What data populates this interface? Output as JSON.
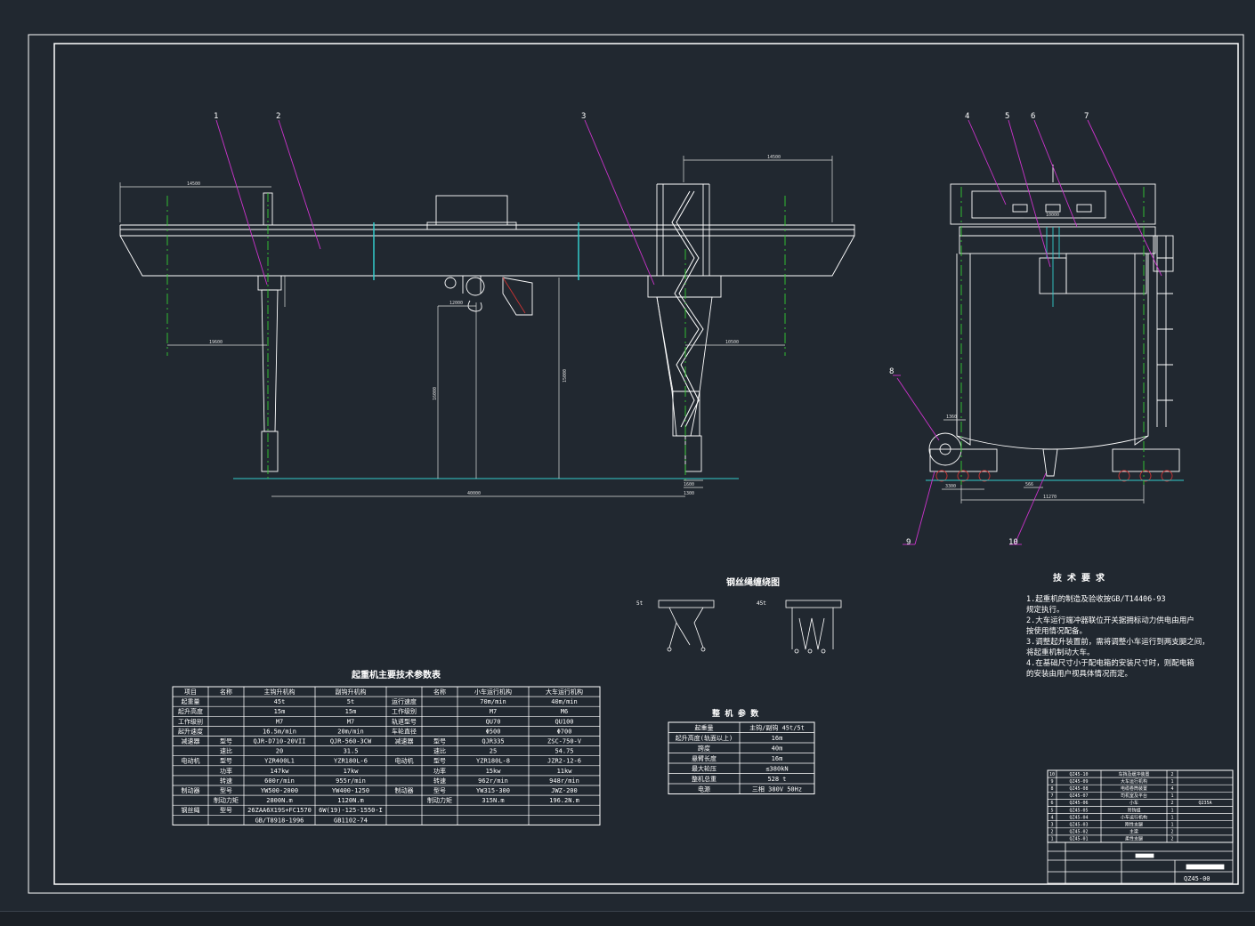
{
  "colors": {
    "background": "#212830",
    "line": "#ffffff",
    "centerline": "#33cc33",
    "leader": "#cc33cc",
    "dimension": "#dddddd",
    "cable": "#33cccc"
  },
  "balloons_front": [
    "1",
    "2",
    "3"
  ],
  "balloons_side": [
    "4",
    "5",
    "6",
    "7",
    "8",
    "9",
    "10"
  ],
  "dims_front": {
    "left_cantilever": "14500",
    "right_cantilever": "14500",
    "span": "40000",
    "trolley_gauge": "12000",
    "lift_height": "16000",
    "lift_height_2": "15000",
    "leg_to_hook_left": "19600",
    "leg_to_hook_right": "10500",
    "small_1": "1600",
    "small_2": "1300"
  },
  "dims_side": {
    "track": "10000",
    "wheelbase": "11270",
    "bogie": "3300",
    "wheel": "1360",
    "small": "566"
  },
  "rope_title": "钢丝绳缠绕图",
  "rope_labels": [
    "5t",
    "45t"
  ],
  "tech_req": {
    "title": "技 术 要 求",
    "lines": [
      "1.起重机的制造及验收按GB/T14406-93",
      "  规定执行。",
      "2.大车运行端冲器联位开关据拥标动力供电由用户",
      "  按使用情况配备。",
      "3.调整起升装置前，需将调整小车运行到两支腿之间，",
      "  将起重机制动大车。",
      "4.在基础尺寸小于配电箱的安装尺寸时，则配电箱",
      "  的安装由用户视具体情况而定。"
    ]
  },
  "params_title": "起重机主要技术参数表",
  "params_table": {
    "header": [
      "项目",
      "名称",
      "主钩升机构",
      "副钩升机构",
      "",
      "名称",
      "小车运行机构",
      "大车运行机构"
    ],
    "rows": [
      [
        "起重量",
        "",
        "45t",
        "5t",
        "运行速度",
        "",
        "70m/min",
        "40m/min"
      ],
      [
        "起升高度",
        "",
        "15m",
        "15m",
        "工作级别",
        "",
        "M7",
        "M6"
      ],
      [
        "工作级别",
        "",
        "M7",
        "M7",
        "轨道型号",
        "",
        "QU70",
        "QU100"
      ],
      [
        "起升速度",
        "",
        "16.5m/min",
        "20m/min",
        "车轮直径",
        "",
        "Φ500",
        "Φ700"
      ],
      [
        "减速器",
        "型号",
        "QJR-D710-20VII",
        "QJR-560-3CW",
        "减速器",
        "型号",
        "QJR335",
        "ZSC-750-V"
      ],
      [
        "",
        "速比",
        "20",
        "31.5",
        "",
        "速比",
        "25",
        "54.75"
      ],
      [
        "电动机",
        "型号",
        "YZR400L1",
        "YZR180L-6",
        "电动机",
        "型号",
        "YZR180L-8",
        "JZR2-12-6"
      ],
      [
        "",
        "功率",
        "147kw",
        "17kw",
        "",
        "功率",
        "15kw",
        "11kw"
      ],
      [
        "",
        "转速",
        "600r/min",
        "955r/min",
        "",
        "转速",
        "962r/min",
        "948r/min"
      ],
      [
        "制动器",
        "型号",
        "YW500-2000",
        "YW400-1250",
        "制动器",
        "型号",
        "YW315-300",
        "JWZ-200"
      ],
      [
        "",
        "制动力矩",
        "2800N.m",
        "1120N.m",
        "",
        "制动力矩",
        "315N.m",
        "196.2N.m"
      ],
      [
        "钢丝绳",
        "型号",
        "26ZAA6X19S+FC1570",
        "6W(19)-125-1550-I",
        "",
        "",
        "",
        ""
      ],
      [
        "",
        "",
        "GB/T8918-1996",
        "GB1102-74",
        "",
        "",
        "",
        ""
      ]
    ]
  },
  "overall_title": "整 机 参 数",
  "overall_table": [
    [
      "起重量",
      "主钩/副钩 45t/5t"
    ],
    [
      "起升高度(轨面以上)",
      "16m"
    ],
    [
      "跨度",
      "40m"
    ],
    [
      "悬臂长度",
      "16m"
    ],
    [
      "最大轮压",
      "≤380kN"
    ],
    [
      "整机总重",
      "528 t"
    ],
    [
      "电源",
      "三相 380V 50Hz"
    ]
  ],
  "parts_list": [
    [
      "10",
      "QZ45-10",
      "车挡及缓冲装置",
      "2",
      ""
    ],
    [
      "9",
      "QZ45-09",
      "大车运行机构",
      "1",
      ""
    ],
    [
      "8",
      "QZ45-08",
      "电缆卷筒装置",
      "4",
      ""
    ],
    [
      "7",
      "QZ45-07",
      "司机室及平台",
      "1",
      ""
    ],
    [
      "6",
      "QZ45-06",
      "小车",
      "2",
      "Q235A"
    ],
    [
      "5",
      "QZ45-05",
      "吊钩组",
      "1",
      ""
    ],
    [
      "4",
      "QZ45-04",
      "小车运行机构",
      "1",
      ""
    ],
    [
      "3",
      "QZ45-03",
      "刚性支腿",
      "1",
      ""
    ],
    [
      "2",
      "QZ45-02",
      "主梁",
      "2",
      ""
    ],
    [
      "1",
      "QZ45-01",
      "柔性支腿",
      "2",
      ""
    ]
  ],
  "drawing_no": "QZ45-00"
}
